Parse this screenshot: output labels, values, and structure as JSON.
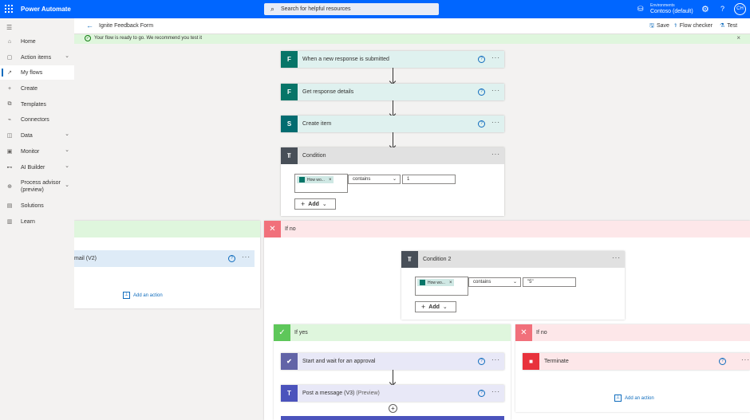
{
  "app": {
    "title": "Power Automate"
  },
  "search": {
    "placeholder": "Search for helpful resources"
  },
  "environment": {
    "label": "Environments",
    "name": "Contoso (default)"
  },
  "user": {
    "initials": "CH"
  },
  "sidebar": {
    "items": [
      {
        "label": "Home",
        "icon": "home-icon"
      },
      {
        "label": "Action items",
        "icon": "clipboard-icon",
        "expandable": true
      },
      {
        "label": "My flows",
        "icon": "flow-icon",
        "active": true
      },
      {
        "label": "Create",
        "icon": "plus-icon"
      },
      {
        "label": "Templates",
        "icon": "templates-icon"
      },
      {
        "label": "Connectors",
        "icon": "connector-icon"
      },
      {
        "label": "Data",
        "icon": "database-icon",
        "expandable": true
      },
      {
        "label": "Monitor",
        "icon": "monitor-icon",
        "expandable": true
      },
      {
        "label": "AI Builder",
        "icon": "ai-icon",
        "expandable": true
      },
      {
        "label_line1": "Process advisor",
        "label_line2": "(preview)",
        "icon": "process-icon",
        "expandable": true
      },
      {
        "label": "Solutions",
        "icon": "solutions-icon"
      },
      {
        "label": "Learn",
        "icon": "book-icon"
      }
    ]
  },
  "header": {
    "flow_name": "Ignite Feedback Form",
    "save": "Save",
    "flow_checker": "Flow checker",
    "test": "Test"
  },
  "notice": {
    "text": "Your flow is ready to go. We recommend you test it"
  },
  "steps": [
    {
      "title": "When a new response is submitted",
      "color": "#077568"
    },
    {
      "title": "Get response details",
      "color": "#077568"
    },
    {
      "title": "Create item",
      "color": "#036c70"
    },
    {
      "title": "Condition",
      "color": "#484f58"
    }
  ],
  "condition1": {
    "token": "How wo...",
    "operator": "contains",
    "value": "1",
    "add": "Add"
  },
  "left_branch": {
    "action_title": "mail (V2)",
    "add_action": "Add an action"
  },
  "if_no": {
    "label": "If no"
  },
  "condition2": {
    "title": "Condition 2",
    "token": "How wo...",
    "operator": "contains",
    "value": "\"5\"",
    "add": "Add"
  },
  "inner_yes": {
    "label": "If yes",
    "actions": [
      {
        "title": "Start and wait for an approval",
        "color": "#6264a7"
      },
      {
        "title": "Post a message (V3)",
        "suffix": "(Preview)",
        "color": "#4b53bc"
      }
    ]
  },
  "inner_no": {
    "label": "If no",
    "action": "Terminate",
    "add_action": "Add an action"
  }
}
